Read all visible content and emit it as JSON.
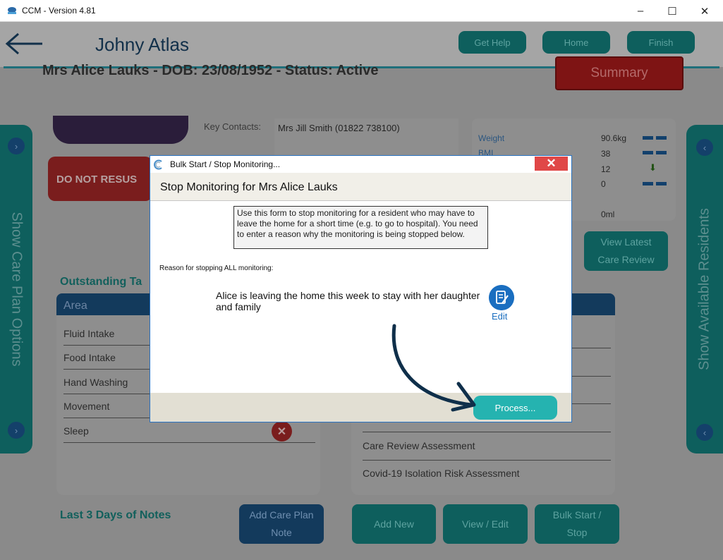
{
  "window": {
    "title": "CCM - Version 4.81",
    "minimize": "–",
    "maximize": "☐",
    "close": "✕"
  },
  "header": {
    "user_name": "Johny Atlas",
    "buttons": [
      "Get Help",
      "Home",
      "Finish"
    ]
  },
  "resident": {
    "title": "Mrs Alice Lauks - DOB: 23/08/1952 - Status: Active",
    "summary_button": "Summary",
    "key_contacts_label": "Key Contacts:",
    "key_contacts_value": "Mrs Jill Smith (01822 738100)",
    "dnr_text": "DO NOT RESUS"
  },
  "side_tabs": {
    "left": "Show Care Plan Options",
    "right": "Show Available Residents"
  },
  "vitals": [
    {
      "label": "Weight",
      "value": "90.6kg",
      "trend": "flat"
    },
    {
      "label": "BMI",
      "value": "38",
      "trend": "flat"
    },
    {
      "label": "",
      "value": "12",
      "trend": "down"
    },
    {
      "label": "",
      "value": "0",
      "trend": "flat"
    },
    {
      "label": "",
      "value": "0ml",
      "trend": ""
    }
  ],
  "view_latest_button": [
    "View Latest",
    "Care Review"
  ],
  "outstanding": {
    "title": "Outstanding Ta",
    "column_header": "Area",
    "rows": [
      "Fluid Intake",
      "Food Intake",
      "Hand Washing",
      "Movement",
      "Sleep"
    ]
  },
  "assessments": {
    "rows": [
      "Care Review Assessment",
      "Covid-19 Isolation Risk Assessment"
    ]
  },
  "notes": {
    "title": "Last 3 Days of Notes",
    "add_button": [
      "Add Care Plan",
      "Note"
    ]
  },
  "bottom_buttons": [
    [
      "Add New"
    ],
    [
      "View / Edit"
    ],
    [
      "Bulk Start /",
      "Stop"
    ]
  ],
  "dialog": {
    "window_title": "Bulk Start / Stop Monitoring...",
    "close": "✕",
    "heading": "Stop Monitoring for Mrs Alice Lauks",
    "info": "Use this form to stop monitoring for a resident who may have to leave the home for a short time (e.g. to go to hospital). You need to enter a reason why the monitoring is being stopped below.",
    "reason_label": "Reason for stopping ALL monitoring:",
    "reason_text": "Alice is leaving the home this week to stay with her daughter and family",
    "edit_label": "Edit",
    "process_button": "Process..."
  },
  "colors": {
    "accent": "#25b3b0",
    "dialog_close": "#e04747",
    "edit_blue": "#1a6ec0",
    "arrow": "#0f2f4a"
  }
}
